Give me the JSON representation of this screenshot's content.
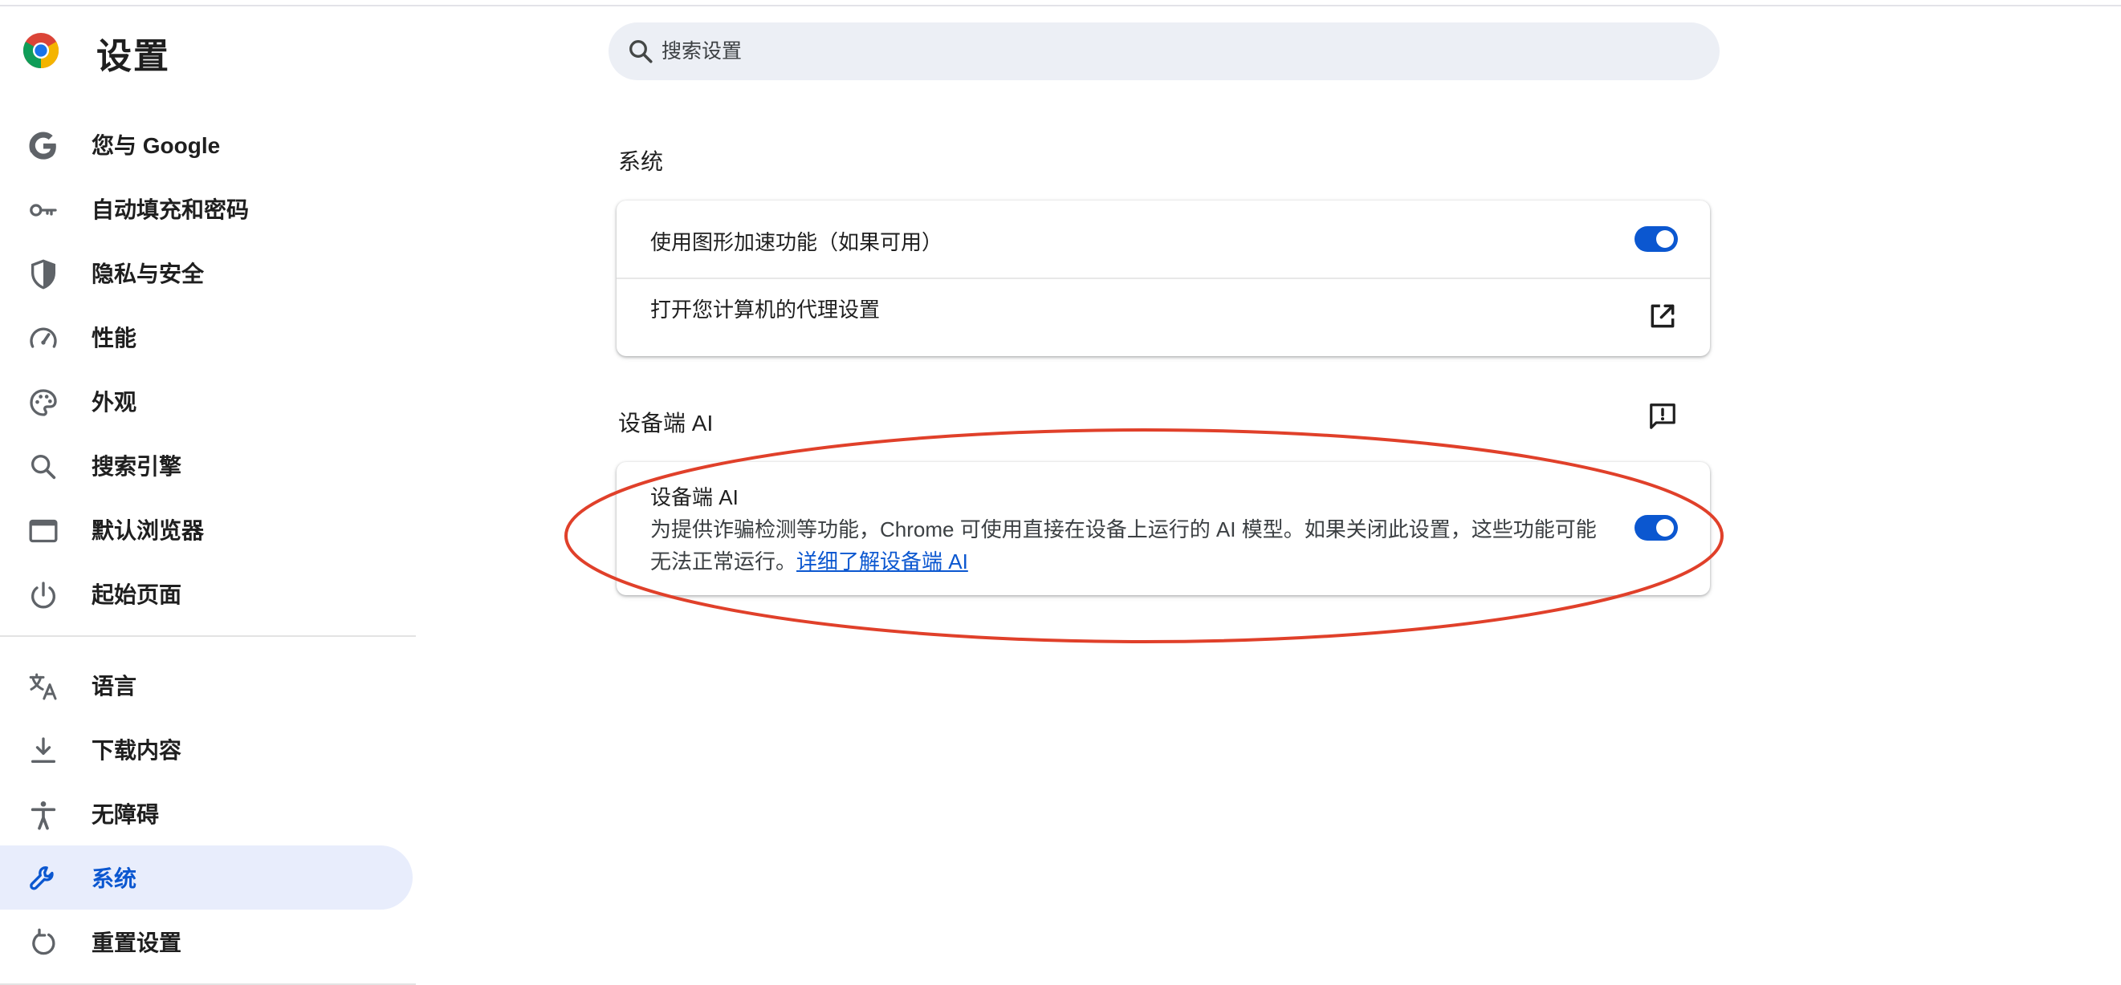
{
  "header": {
    "title": "设置",
    "search": {
      "placeholder": "搜索设置",
      "value": ""
    }
  },
  "sidebar": {
    "items": [
      {
        "label": "您与 Google",
        "icon": "google-g-icon"
      },
      {
        "label": "自动填充和密码",
        "icon": "key-icon"
      },
      {
        "label": "隐私与安全",
        "icon": "shield-icon"
      },
      {
        "label": "性能",
        "icon": "speedometer-icon"
      },
      {
        "label": "外观",
        "icon": "palette-icon"
      },
      {
        "label": "搜索引擎",
        "icon": "search-icon"
      },
      {
        "label": "默认浏览器",
        "icon": "browser-window-icon"
      },
      {
        "label": "起始页面",
        "icon": "power-icon"
      },
      {
        "label": "语言",
        "icon": "translate-icon"
      },
      {
        "label": "下载内容",
        "icon": "download-icon"
      },
      {
        "label": "无障碍",
        "icon": "accessibility-icon"
      },
      {
        "label": "系统",
        "icon": "wrench-icon",
        "active": true
      },
      {
        "label": "重置设置",
        "icon": "reset-icon"
      }
    ]
  },
  "main": {
    "system_section": {
      "title": "系统",
      "rows": [
        {
          "label": "使用图形加速功能（如果可用）",
          "control": "toggle",
          "on": true
        },
        {
          "label": "打开您计算机的代理设置",
          "control": "external-link-icon"
        }
      ]
    },
    "ai_section": {
      "title": "设备端 AI",
      "feedback_icon": "feedback-icon",
      "row": {
        "title": "设备端 AI",
        "description": "为提供诈骗检测等功能，Chrome 可使用直接在设备上运行的 AI 模型。如果关闭此设置，这些功能可能无法正常运行。",
        "link_text": "详细了解设备端 AI",
        "control": "toggle",
        "on": true
      }
    }
  },
  "colors": {
    "accent": "#0b57d0",
    "active_nav_bg": "#e8edfc",
    "search_bg": "#eceff5",
    "annotation": "#e0402a"
  }
}
